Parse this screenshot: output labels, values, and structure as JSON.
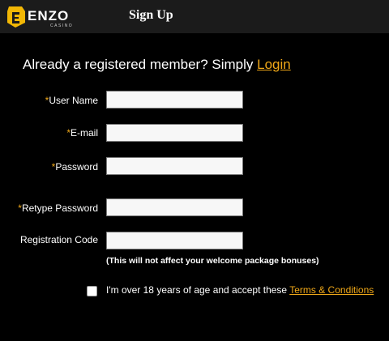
{
  "header": {
    "logo_text": "ENZO",
    "logo_subtext": "CASINO",
    "title": "Sign Up"
  },
  "intro": {
    "text": "Already a registered member? Simply ",
    "login_link": "Login"
  },
  "form": {
    "required_mark": "*",
    "fields": [
      {
        "label": "User Name",
        "required": true,
        "value": ""
      },
      {
        "label": "E-mail",
        "required": true,
        "value": ""
      },
      {
        "label": "Password",
        "required": true,
        "value": ""
      },
      {
        "label": "Retype Password",
        "required": true,
        "value": ""
      },
      {
        "label": "Registration Code",
        "required": false,
        "value": ""
      }
    ],
    "registration_note": "(This will not affect your welcome package bonuses)",
    "agree_text": "I'm over 18 years of age and accept these ",
    "terms_link": "Terms & Conditions",
    "agree_checked": false
  },
  "colors": {
    "background": "#000000",
    "header_bg": "#1b1b1b",
    "accent": "#f0a818",
    "logo_badge": "#f2b705"
  }
}
